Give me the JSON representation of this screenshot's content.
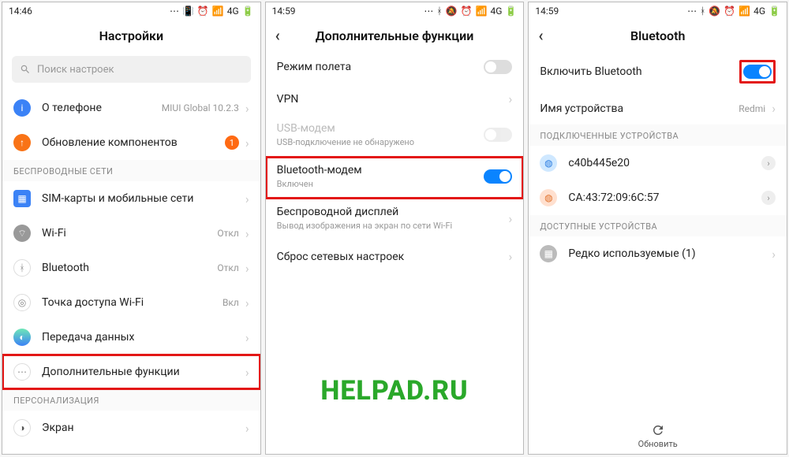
{
  "watermark": "HELPAD.RU",
  "screen1": {
    "time": "14:46",
    "status_signal": "4G",
    "title": "Настройки",
    "search_placeholder": "Поиск настроек",
    "about_label": "О телефоне",
    "about_value": "MIUI Global 10.2.3",
    "update_label": "Обновление компонентов",
    "update_badge": "1",
    "section_wireless": "БЕСПРОВОДНЫЕ СЕТИ",
    "sim_label": "SIM-карты и мобильные сети",
    "wifi_label": "Wi-Fi",
    "wifi_value": "Откл",
    "bt_label": "Bluetooth",
    "bt_value": "Откл",
    "hotspot_label": "Точка доступа Wi-Fi",
    "hotspot_value": "Вкл",
    "data_label": "Передача данных",
    "more_label": "Дополнительные функции",
    "section_personal": "ПЕРСОНАЛИЗАЦИЯ",
    "display_label": "Экран"
  },
  "screen2": {
    "time": "14:59",
    "status_signal": "4G",
    "title": "Дополнительные функции",
    "airplane_label": "Режим полета",
    "vpn_label": "VPN",
    "usb_label": "USB-модем",
    "usb_sub": "USB-подключение не обнаружено",
    "btmodem_label": "Bluetooth-модем",
    "btmodem_sub": "Включен",
    "wdisplay_label": "Беспроводной дисплей",
    "wdisplay_sub": "Вывод изображения на экран по сети Wi-Fi",
    "reset_label": "Сброс сетевых настроек"
  },
  "screen3": {
    "time": "14:59",
    "status_signal": "4G",
    "title": "Bluetooth",
    "enable_label": "Включить Bluetooth",
    "name_label": "Имя устройства",
    "name_value": "Redmi",
    "section_connected": "ПОДКЛЮЧЕННЫЕ УСТРОЙСТВА",
    "dev1": "c40b445e20",
    "dev2": "CA:43:72:09:6C:57",
    "section_available": "ДОСТУПНЫЕ УСТРОЙСТВА",
    "rare_label": "Редко используемые (1)",
    "refresh_label": "Обновить"
  }
}
